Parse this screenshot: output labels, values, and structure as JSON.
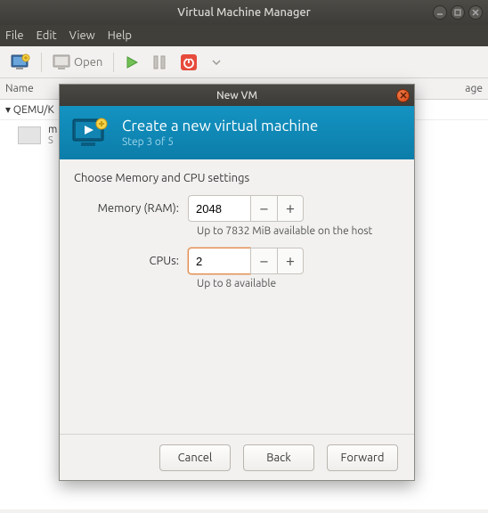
{
  "window": {
    "title": "Virtual Machine Manager"
  },
  "menu": {
    "file": "File",
    "edit": "Edit",
    "view": "View",
    "help": "Help"
  },
  "toolbar": {
    "open_label": "Open"
  },
  "list": {
    "col_name": "Name",
    "col_usage": "age",
    "connection": "▾ QEMU/K",
    "vm_name": "m",
    "vm_state": "S"
  },
  "dialog": {
    "titlebar": "New VM",
    "header_title": "Create a new virtual machine",
    "header_step": "Step 3 of 5",
    "heading": "Choose Memory and CPU settings",
    "memory_label": "Memory (RAM):",
    "memory_value": "2048",
    "memory_hint": "Up to 7832 MiB available on the host",
    "cpus_label": "CPUs:",
    "cpus_value": "2",
    "cpus_hint": "Up to 8 available",
    "cancel": "Cancel",
    "back": "Back",
    "forward": "Forward"
  }
}
